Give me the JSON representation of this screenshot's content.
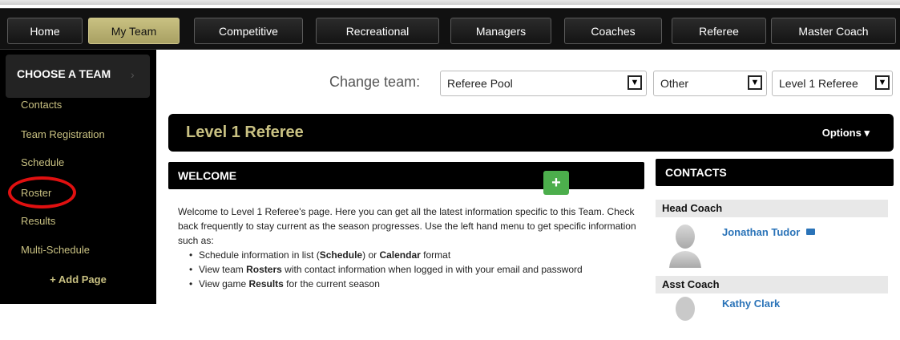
{
  "nav": {
    "items": [
      {
        "label": "Home"
      },
      {
        "label": "My Team"
      },
      {
        "label": "Competitive"
      },
      {
        "label": "Recreational"
      },
      {
        "label": "Managers"
      },
      {
        "label": "Coaches"
      },
      {
        "label": "Referee"
      },
      {
        "label": "Master Coach"
      }
    ],
    "active": "My Team"
  },
  "sidebar": {
    "header": "CHOOSE A TEAM",
    "items": [
      {
        "label": "Contacts"
      },
      {
        "label": "Team Registration"
      },
      {
        "label": "Schedule"
      },
      {
        "label": "Roster"
      },
      {
        "label": "Results"
      },
      {
        "label": "Multi-Schedule"
      }
    ],
    "add_page": "+ Add Page"
  },
  "team_picker": {
    "label": "Change team:",
    "selects": [
      {
        "value": "Referee Pool"
      },
      {
        "value": "Other"
      },
      {
        "value": "Level 1 Referee"
      }
    ]
  },
  "team": {
    "title": "Level 1 Referee",
    "options_label": "Options ▾"
  },
  "welcome": {
    "heading": "WELCOME",
    "plus_label": "+",
    "intro": "Welcome to Level 1 Referee's page. Here you can get all the latest information specific to this Team. Check back frequently to stay current as the season progresses. Use the left hand menu to get specific information such as:",
    "bullets": [
      {
        "pre": "Schedule information in list (",
        "b1": "Schedule",
        "mid": ") or ",
        "b2": "Calendar",
        "post": " format"
      },
      {
        "pre": "View team ",
        "b1": "Rosters",
        "mid": " with contact information when logged in with your email and password",
        "b2": "",
        "post": ""
      },
      {
        "pre": "View game ",
        "b1": "Results",
        "mid": " for the current season",
        "b2": "",
        "post": ""
      }
    ]
  },
  "contacts": {
    "heading": "CONTACTS",
    "roles": [
      {
        "role": "Head Coach",
        "name": "Jonathan Tudor"
      },
      {
        "role": "Asst Coach",
        "name": "Kathy Clark"
      }
    ]
  },
  "colors": {
    "accent_gold": "#c9c182",
    "link_blue": "#2a73b8",
    "plus_green": "#4cae4c",
    "highlight_red": "#e01010"
  }
}
